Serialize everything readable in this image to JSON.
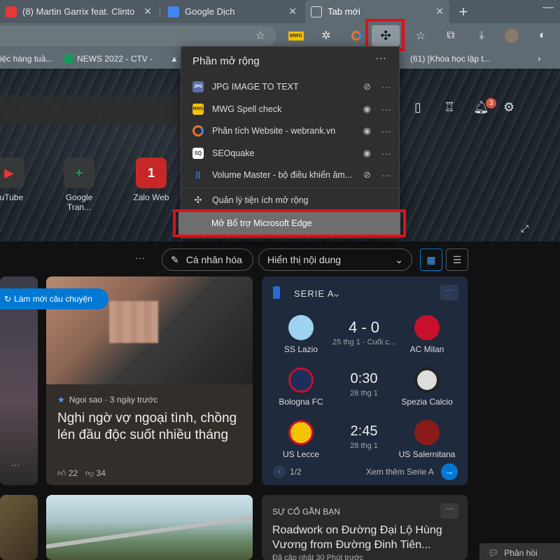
{
  "tabs": [
    {
      "title": "(8) Martin Garrix feat. Clinto",
      "icon_color": "#e53935"
    },
    {
      "title": "Google Dịch",
      "icon_color": "#4285f4"
    },
    {
      "title": "Tab mới",
      "active": true
    }
  ],
  "toolbar": {
    "extension_badge": "MWG"
  },
  "bookmarks": [
    "iệc hàng tuầ...",
    "NEWS 2022 - CTV -",
    "(61) [Khóa học lập t..."
  ],
  "extensions_menu": {
    "title": "Phần mở rộng",
    "items": [
      {
        "label": "JPG IMAGE TO TEXT",
        "icon_color": "#5a6fa8",
        "icon_text": "JPG",
        "visible": false
      },
      {
        "label": "MWG Spell check",
        "icon_color": "#f5c400",
        "icon_text": "MWG",
        "visible": true
      },
      {
        "label": "Phân tích Website - webrank.vn",
        "icon_color": "#e8742a",
        "icon_text": "W",
        "visible": true
      },
      {
        "label": "SEOquake",
        "icon_color": "#ffffff",
        "icon_text": "SQ",
        "visible": true
      },
      {
        "label": "Volume Master - bộ điều khiển âm...",
        "icon_color": "#3b7dd8",
        "icon_text": "))",
        "visible": false
      }
    ],
    "manage_label": "Quản lý tiện ích mở rộng",
    "addons_label": "Mở Bổ trợ Microsoft Edge"
  },
  "header": {
    "notification_count": "3"
  },
  "quick_links": [
    {
      "label": "ouTube",
      "icon": "▶",
      "color": "#e53935"
    },
    {
      "label": "Google Tran...",
      "icon": "+",
      "color": "#0f9d58"
    },
    {
      "label": "Zalo Web",
      "icon": "1",
      "color": "#e53935"
    }
  ],
  "feed_controls": {
    "personalize": "Cá nhân hóa",
    "content_select": "Hiển thị nội dung",
    "refresh": "Làm mới câu chuyện"
  },
  "news_card": {
    "source": "Ngoi sao · 3 ngày trước",
    "headline": "Nghi ngờ vợ ngoại tình, chồng lén đầu độc suốt nhiều tháng",
    "likes": "22",
    "dislikes": "34"
  },
  "sports": {
    "league": "SERIE A",
    "matches": [
      {
        "home": "SS Lazio",
        "away": "AC Milan",
        "score": "4 - 0",
        "date": "25 thg 1 - Cuối c...",
        "home_color": "#9fd3f0",
        "away_color": "#c8102e"
      },
      {
        "home": "Bologna FC",
        "away": "Spezia Calcio",
        "score": "0:30",
        "date": "28 thg 1",
        "home_color": "#1a2f5a",
        "away_color": "#dddddd"
      },
      {
        "home": "US Lecce",
        "away": "US Salernitana",
        "score": "2:45",
        "date": "28 thg 1",
        "home_color": "#f5c400",
        "away_color": "#8b1a1a"
      }
    ],
    "pager": "1/2",
    "see_more": "Xem thêm Serie A"
  },
  "nearby": {
    "title": "SỰ CỐ GẦN BẠN",
    "headline": "Roadwork on Đường Đại Lộ Hùng Vương from Đường Đinh Tiên...",
    "meta": "Đã cập nhật 30 Phút trước"
  },
  "feedback": "Phản hồi"
}
